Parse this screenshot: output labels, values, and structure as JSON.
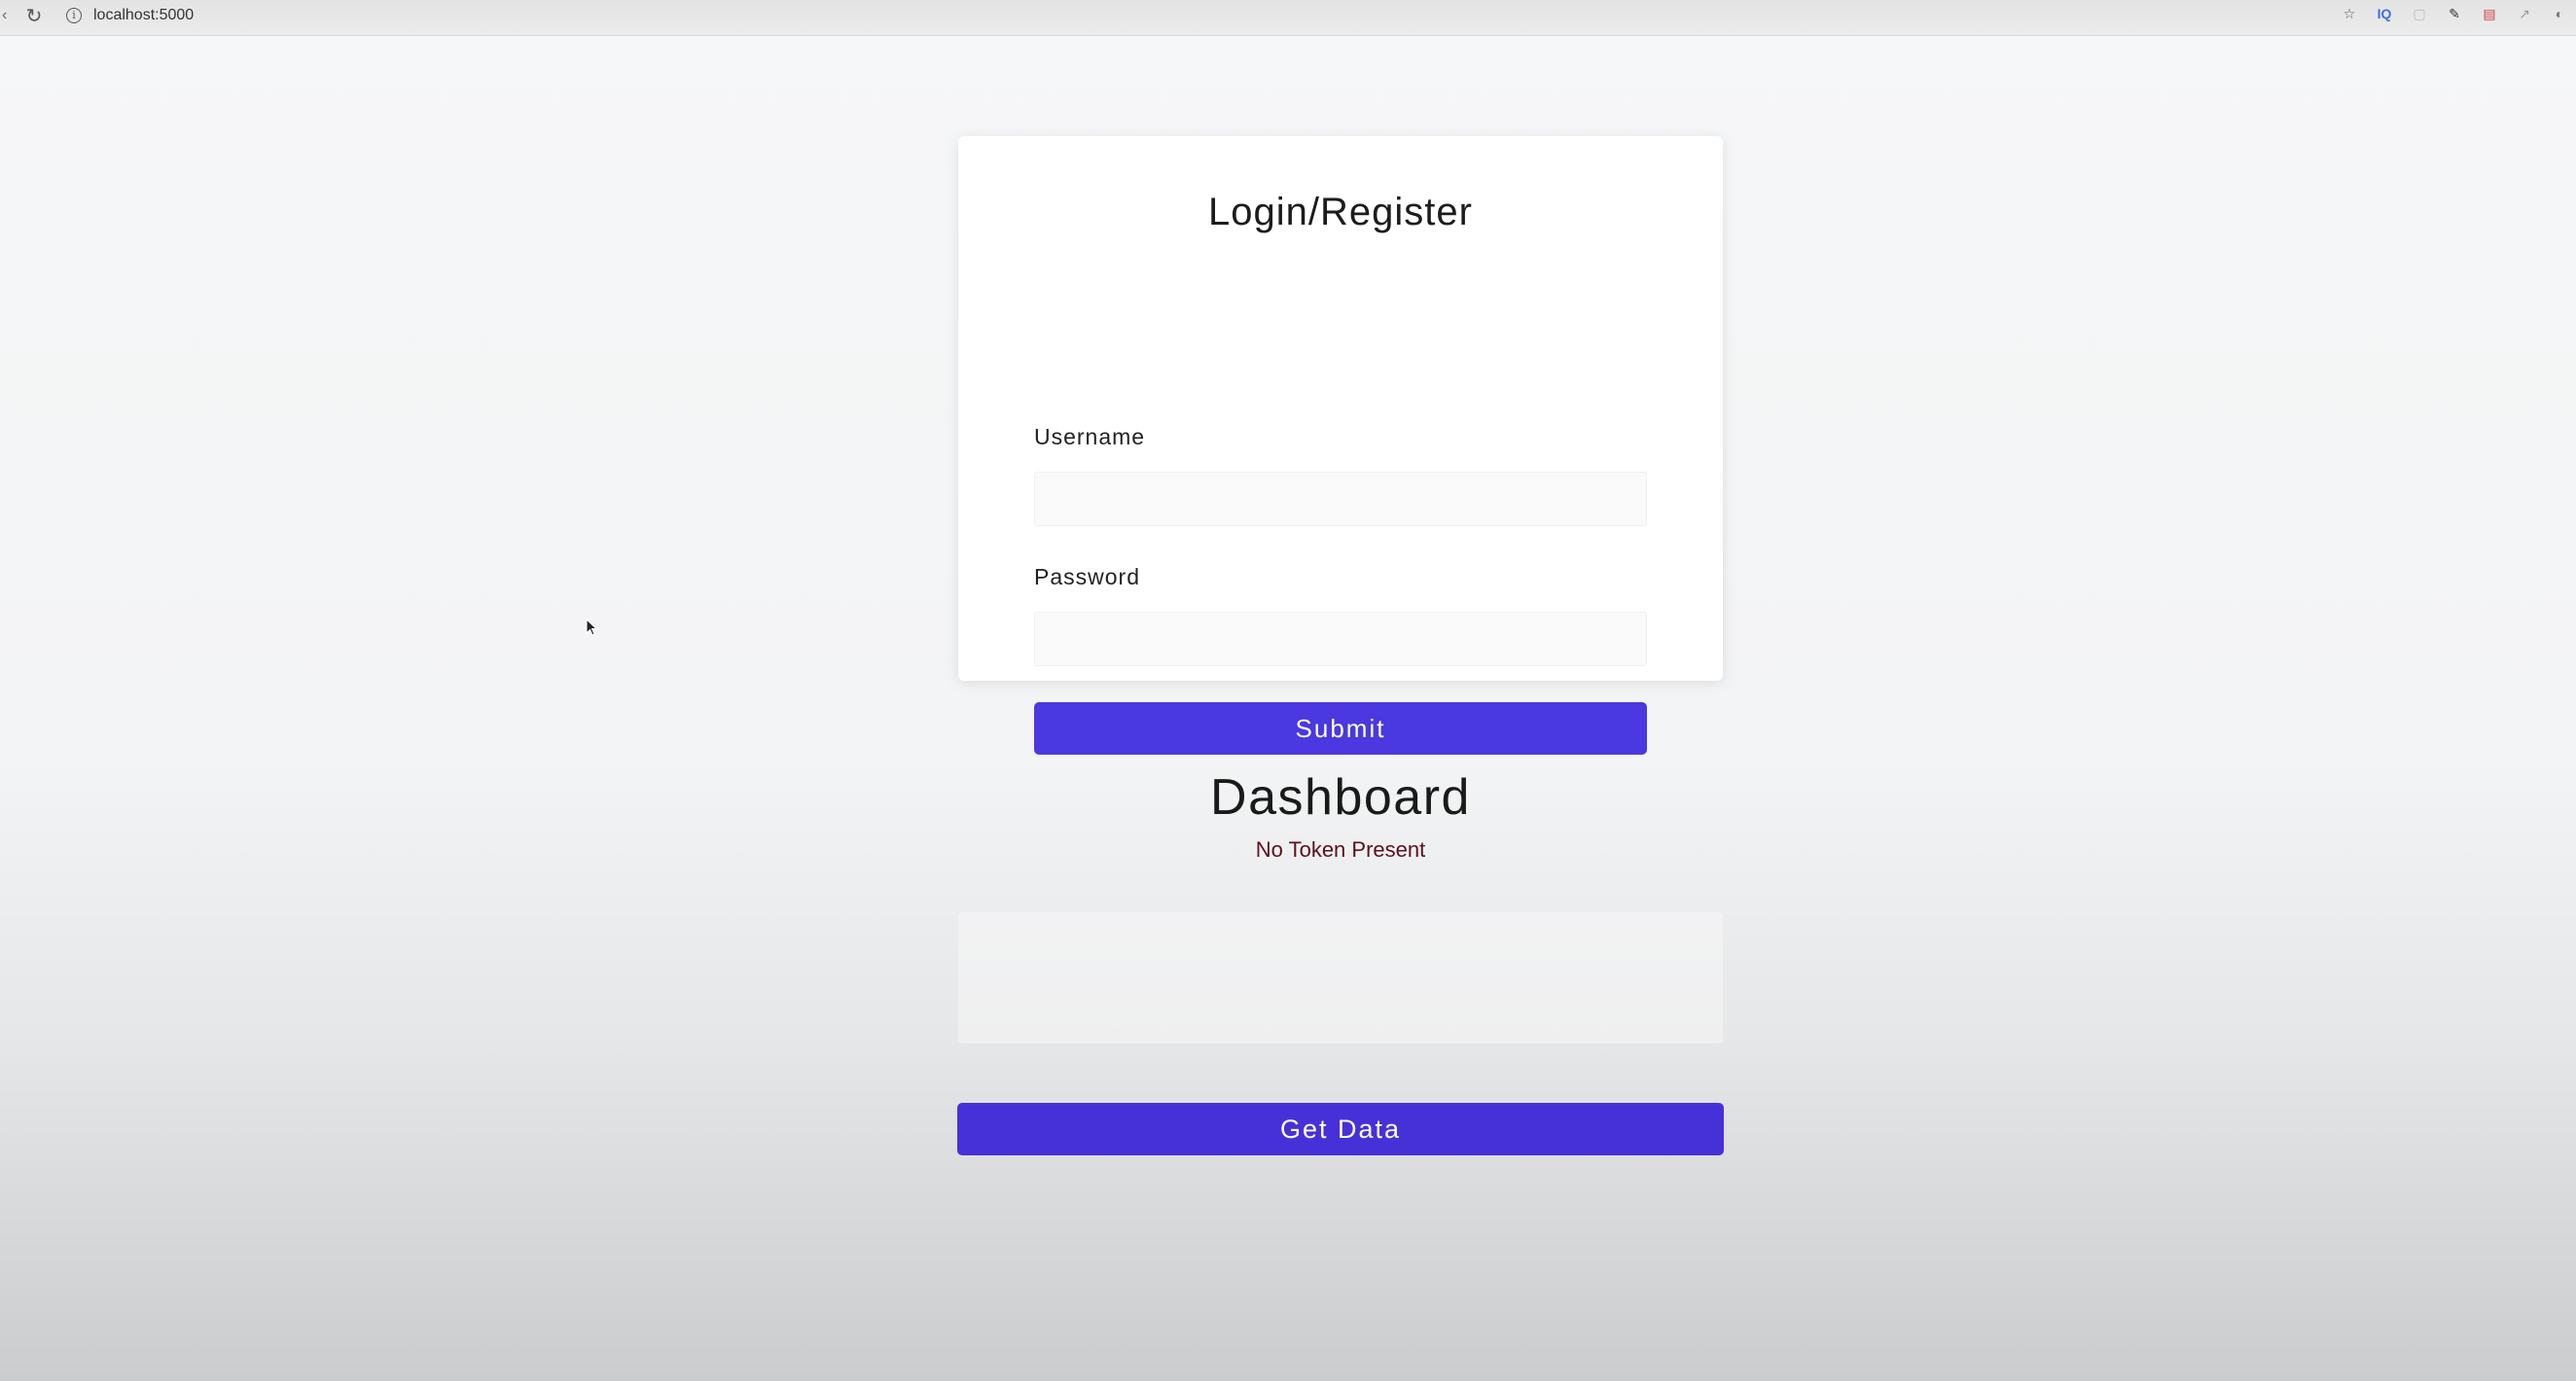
{
  "browser": {
    "url": "localhost:5000",
    "icons": [
      "back-icon",
      "reload-icon",
      "info-icon",
      "bookmark-star-icon",
      "extension-icons"
    ]
  },
  "login": {
    "title": "Login/Register",
    "username_label": "Username",
    "username_value": "",
    "password_label": "Password",
    "password_value": "",
    "submit_label": "Submit"
  },
  "dashboard": {
    "title": "Dashboard",
    "status": "No Token Present",
    "data": "",
    "get_data_label": "Get Data"
  },
  "colors": {
    "primary_button": "#4a38e0",
    "status_text": "#5a1020",
    "background": "#f4f5f6"
  }
}
